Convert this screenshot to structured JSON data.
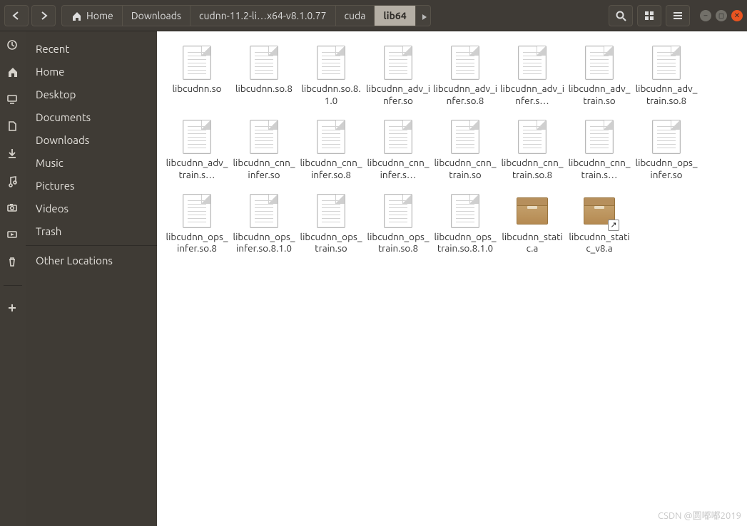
{
  "breadcrumbs": {
    "home_icon_label": "Home",
    "items": [
      "Downloads",
      "cudnn-11.2-li…x64-v8.1.0.77",
      "cuda",
      "lib64"
    ],
    "active_index": 3
  },
  "launcher": {
    "items": [
      {
        "name": "recent-icon",
        "glyph": "clock"
      },
      {
        "name": "home-icon",
        "glyph": "home"
      },
      {
        "name": "desktop-icon",
        "glyph": "desktop"
      },
      {
        "name": "documents-icon",
        "glyph": "doc"
      },
      {
        "name": "downloads-icon",
        "glyph": "download"
      },
      {
        "name": "music-icon",
        "glyph": "music"
      },
      {
        "name": "pictures-icon",
        "glyph": "camera"
      },
      {
        "name": "videos-icon",
        "glyph": "video"
      },
      {
        "name": "trash-icon",
        "glyph": "trash"
      },
      {
        "name": "other-loc-icon",
        "glyph": "plus"
      }
    ]
  },
  "sidebar": {
    "items": [
      {
        "label": "Recent"
      },
      {
        "label": "Home"
      },
      {
        "label": "Desktop"
      },
      {
        "label": "Documents"
      },
      {
        "label": "Downloads"
      },
      {
        "label": "Music"
      },
      {
        "label": "Pictures"
      },
      {
        "label": "Videos"
      },
      {
        "label": "Trash"
      },
      {
        "label": "Other Locations",
        "sep_before": true
      }
    ]
  },
  "files": [
    {
      "name": "libcudnn.so",
      "type": "text"
    },
    {
      "name": "libcudnn.so.8",
      "type": "text"
    },
    {
      "name": "libcudnn.so.8.1.0",
      "type": "text"
    },
    {
      "name": "libcudnn_adv_infer.so",
      "type": "text"
    },
    {
      "name": "libcudnn_adv_infer.so.8",
      "type": "text"
    },
    {
      "name": "libcudnn_adv_infer.s…",
      "type": "text"
    },
    {
      "name": "libcudnn_adv_train.so",
      "type": "text"
    },
    {
      "name": "libcudnn_adv_train.so.8",
      "type": "text"
    },
    {
      "name": "libcudnn_adv_train.s…",
      "type": "text"
    },
    {
      "name": "libcudnn_cnn_infer.so",
      "type": "text"
    },
    {
      "name": "libcudnn_cnn_infer.so.8",
      "type": "text"
    },
    {
      "name": "libcudnn_cnn_infer.s…",
      "type": "text"
    },
    {
      "name": "libcudnn_cnn_train.so",
      "type": "text"
    },
    {
      "name": "libcudnn_cnn_train.so.8",
      "type": "text"
    },
    {
      "name": "libcudnn_cnn_train.s…",
      "type": "text"
    },
    {
      "name": "libcudnn_ops_infer.so",
      "type": "text"
    },
    {
      "name": "libcudnn_ops_infer.so.8",
      "type": "text"
    },
    {
      "name": "libcudnn_ops_infer.so.8.1.0",
      "type": "text"
    },
    {
      "name": "libcudnn_ops_train.so",
      "type": "text"
    },
    {
      "name": "libcudnn_ops_train.so.8",
      "type": "text"
    },
    {
      "name": "libcudnn_ops_train.so.8.1.0",
      "type": "text"
    },
    {
      "name": "libcudnn_static.a",
      "type": "archive"
    },
    {
      "name": "libcudnn_static_v8.a",
      "type": "archive",
      "shortcut": true
    }
  ],
  "watermark": "CSDN @圆嘟嘟2019"
}
